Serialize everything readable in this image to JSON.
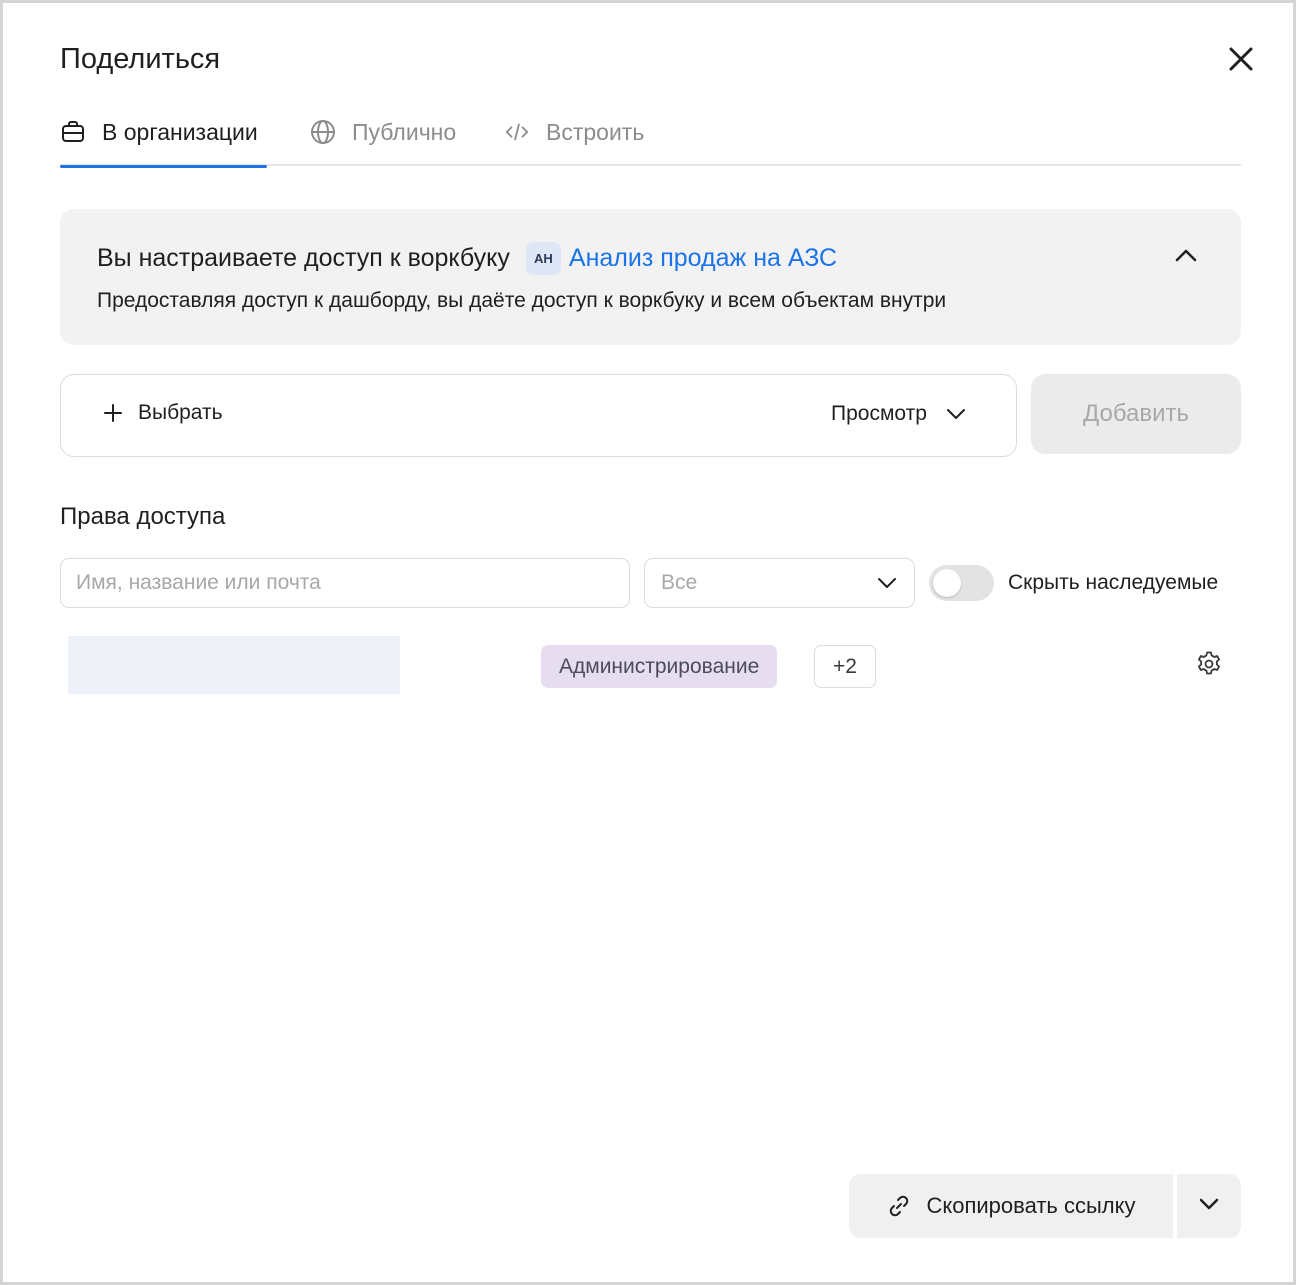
{
  "dialog": {
    "title": "Поделиться",
    "close_icon": "close-icon"
  },
  "tabs": [
    {
      "label": "В организации",
      "icon": "briefcase-icon",
      "active": true
    },
    {
      "label": "Публично",
      "icon": "globe-icon",
      "active": false
    },
    {
      "label": "Встроить",
      "icon": "code-icon",
      "active": false
    }
  ],
  "info": {
    "title": "Вы настраиваете доступ к воркбуку",
    "badge": "АН",
    "workbook_link": "Анализ продаж на АЗС",
    "description": "Предоставляя доступ к дашборду, вы даёте доступ к воркбуку и всем объектам внутри",
    "accent_color": "#1a73e8"
  },
  "subject_picker": {
    "choose_label": "Выбрать",
    "role_value": "Просмотр",
    "add_label": "Добавить"
  },
  "permissions": {
    "title": "Права доступа",
    "search_placeholder": "Имя, название или почта",
    "filter_value": "Все",
    "hide_inherited_label": "Скрыть наследуемые",
    "hide_inherited_on": false,
    "rows": [
      {
        "role": "Администрирование",
        "extra_count": "+2"
      }
    ]
  },
  "footer": {
    "copy_link_label": "Скопировать ссылку"
  }
}
